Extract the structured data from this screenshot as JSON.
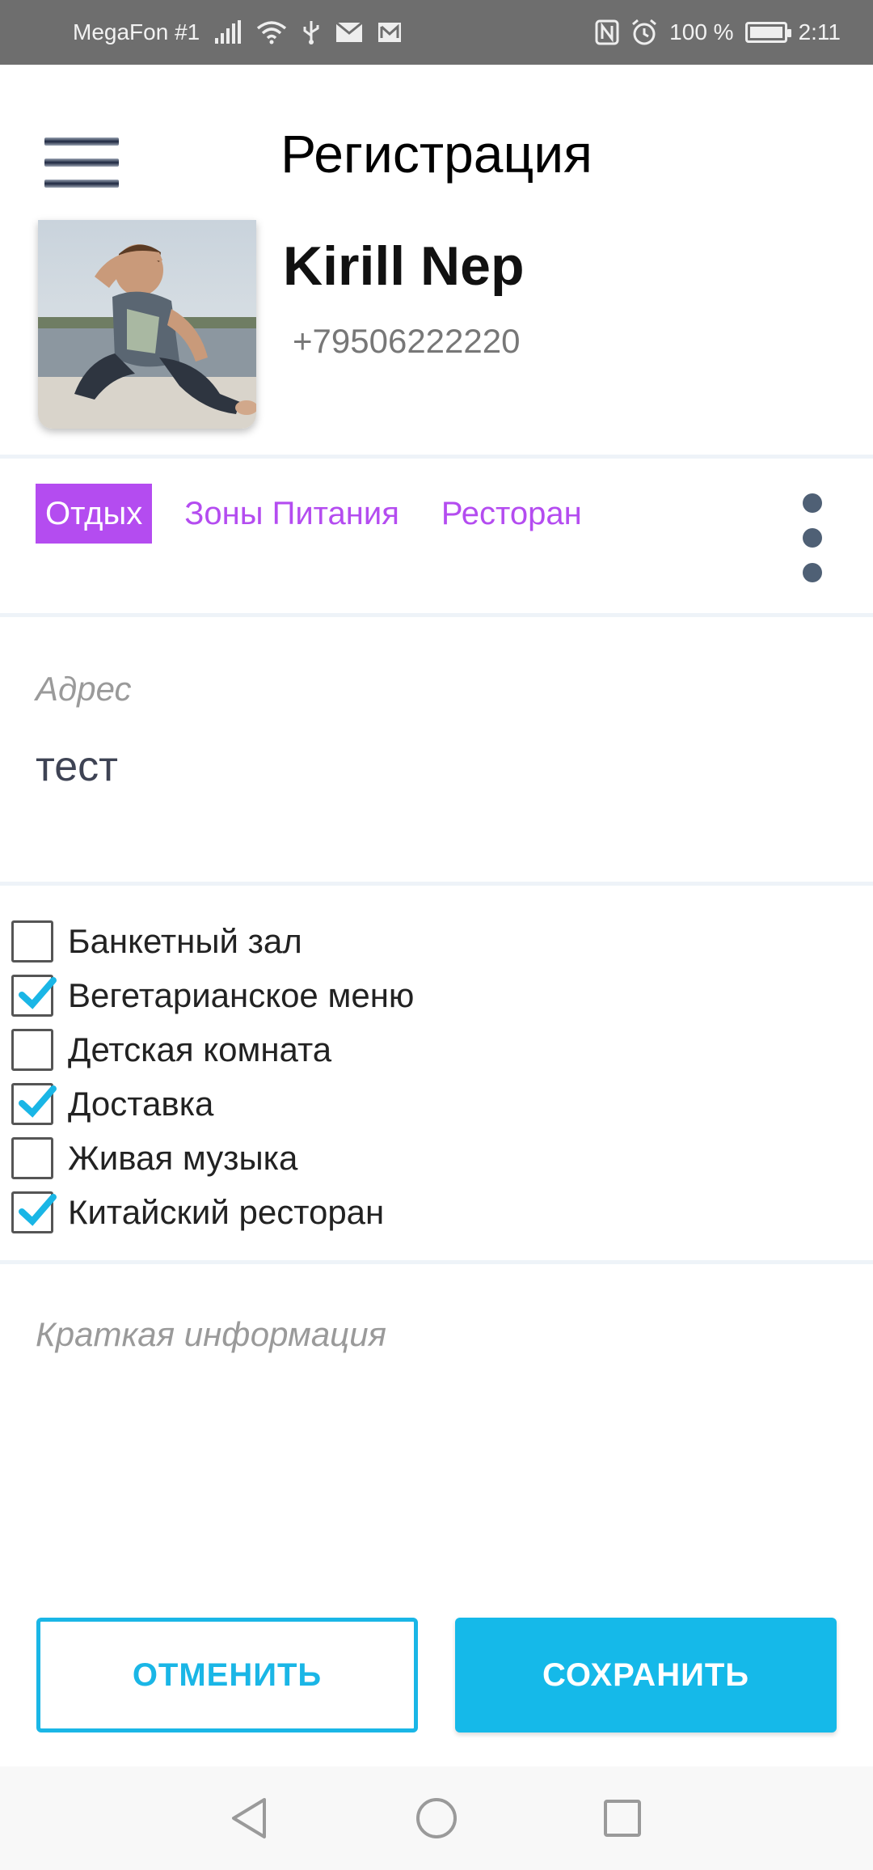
{
  "status_bar": {
    "carrier": "MegaFon #1",
    "battery_percent": "100 %",
    "time": "2:11",
    "icons": [
      "signal-icon",
      "wifi-icon",
      "usb-icon",
      "mail-icon",
      "mail-icon",
      "nfc-icon",
      "alarm-icon",
      "battery-icon"
    ]
  },
  "header": {
    "title": "Регистрация"
  },
  "profile": {
    "name": "Kirill Nep",
    "phone": "+79506222220"
  },
  "tabs": [
    {
      "label": "Отдых",
      "active": true
    },
    {
      "label": "Зоны Питания",
      "active": false
    },
    {
      "label": "Ресторан",
      "active": false
    }
  ],
  "address": {
    "label": "Адрес",
    "value": "тест"
  },
  "options": [
    {
      "label": "Банкетный зал",
      "checked": false
    },
    {
      "label": "Вегетарианское меню",
      "checked": true
    },
    {
      "label": "Детская комната",
      "checked": false
    },
    {
      "label": "Доставка",
      "checked": true
    },
    {
      "label": "Живая музыка",
      "checked": false
    },
    {
      "label": "Китайский ресторан",
      "checked": true
    }
  ],
  "info": {
    "placeholder": "Краткая информация"
  },
  "buttons": {
    "cancel": "ОТМЕНИТЬ",
    "save": "СОХРАНИТЬ"
  },
  "colors": {
    "accent": "#b44cf0",
    "primary": "#15b9e9",
    "check": "#1ab6e6"
  }
}
